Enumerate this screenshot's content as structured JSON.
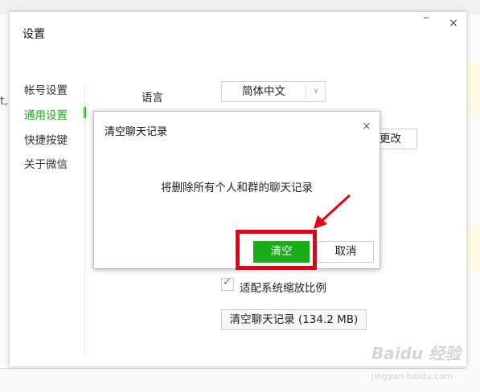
{
  "background": {
    "edge_char": "t,"
  },
  "window": {
    "title": "设置",
    "minimize_glyph": "‾",
    "close_glyph": "×"
  },
  "nav": {
    "items": [
      {
        "label": "帐号设置",
        "active": false
      },
      {
        "label": "通用设置",
        "active": true
      },
      {
        "label": "快捷按键",
        "active": false
      },
      {
        "label": "关于微信",
        "active": false
      }
    ]
  },
  "general": {
    "language_label": "语言",
    "language_value": "简体中文",
    "change_button_partial": "更改",
    "scale_checkbox_label": "适配系统缩放比例",
    "scale_checked": true,
    "clear_history_button": "清空聊天记录 (134.2 MB)"
  },
  "dialog": {
    "title": "清空聊天记录",
    "close_glyph": "×",
    "message": "将删除所有个人和群的聊天记录",
    "confirm_label": "清空",
    "cancel_label": "取消"
  },
  "colors": {
    "accent_green": "#1aad19",
    "highlight_red": "#e60012"
  },
  "watermark": {
    "main": "Baidu 经验",
    "sub": "jingyan.baidu.com"
  }
}
